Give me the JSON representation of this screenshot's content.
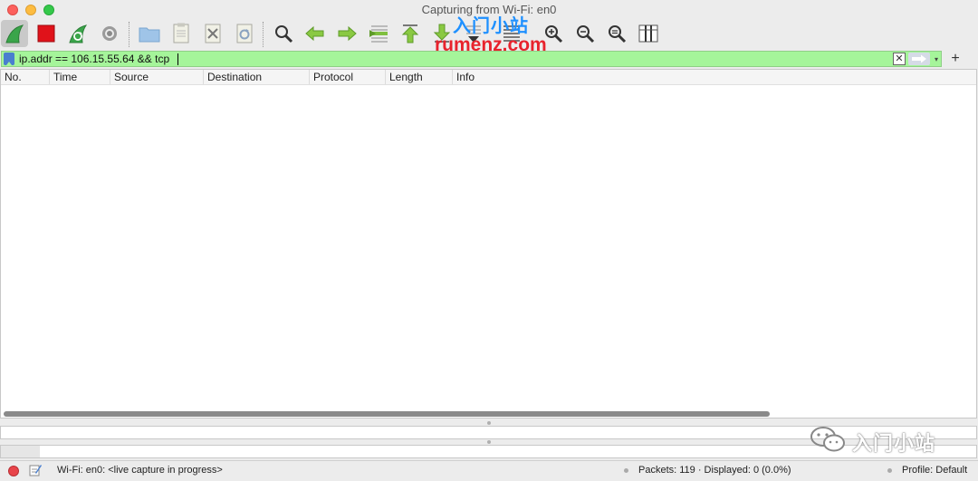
{
  "window": {
    "title": "Capturing from Wi-Fi: en0"
  },
  "toolbar": {
    "buttons": [
      {
        "name": "start-capture-icon",
        "label": "Start capture"
      },
      {
        "name": "stop-capture-icon",
        "label": "Stop capture"
      },
      {
        "name": "restart-capture-icon",
        "label": "Restart capture"
      },
      {
        "name": "capture-options-icon",
        "label": "Capture options"
      },
      {
        "name": "open-file-icon",
        "label": "Open"
      },
      {
        "name": "save-file-icon",
        "label": "Save"
      },
      {
        "name": "close-file-icon",
        "label": "Close"
      },
      {
        "name": "reload-file-icon",
        "label": "Reload"
      },
      {
        "name": "find-packet-icon",
        "label": "Find packet"
      },
      {
        "name": "go-back-icon",
        "label": "Go back"
      },
      {
        "name": "go-forward-icon",
        "label": "Go forward"
      },
      {
        "name": "go-to-packet-icon",
        "label": "Go to packet"
      },
      {
        "name": "go-first-icon",
        "label": "First packet"
      },
      {
        "name": "go-last-icon",
        "label": "Last packet"
      },
      {
        "name": "auto-scroll-icon",
        "label": "Auto scroll"
      },
      {
        "name": "colorize-icon",
        "label": "Colorize"
      },
      {
        "name": "zoom-in-icon",
        "label": "Zoom in"
      },
      {
        "name": "zoom-out-icon",
        "label": "Zoom out"
      },
      {
        "name": "zoom-reset-icon",
        "label": "Normal size"
      },
      {
        "name": "resize-columns-icon",
        "label": "Resize columns"
      }
    ]
  },
  "watermark": {
    "cn": "入门小站",
    "en": "rumenz.com"
  },
  "filter": {
    "value": "ip.addr == 106.15.55.64 && tcp",
    "clear_glyph": "✕",
    "dropdown_glyph": "▾",
    "add_glyph": "+"
  },
  "packet_list": {
    "columns": [
      "No.",
      "Time",
      "Source",
      "Destination",
      "Protocol",
      "Length",
      "Info"
    ]
  },
  "statusbar": {
    "interface": "Wi-Fi: en0: <live capture in progress>",
    "packets": "Packets: 119 · Displayed: 0 (0.0%)",
    "profile": "Profile: Default"
  },
  "wechat_watermark": {
    "text": "入门小站"
  },
  "colors": {
    "filter_valid": "#a5f59a",
    "accent_green": "#3bb54a",
    "stop_red": "#e0121a"
  }
}
